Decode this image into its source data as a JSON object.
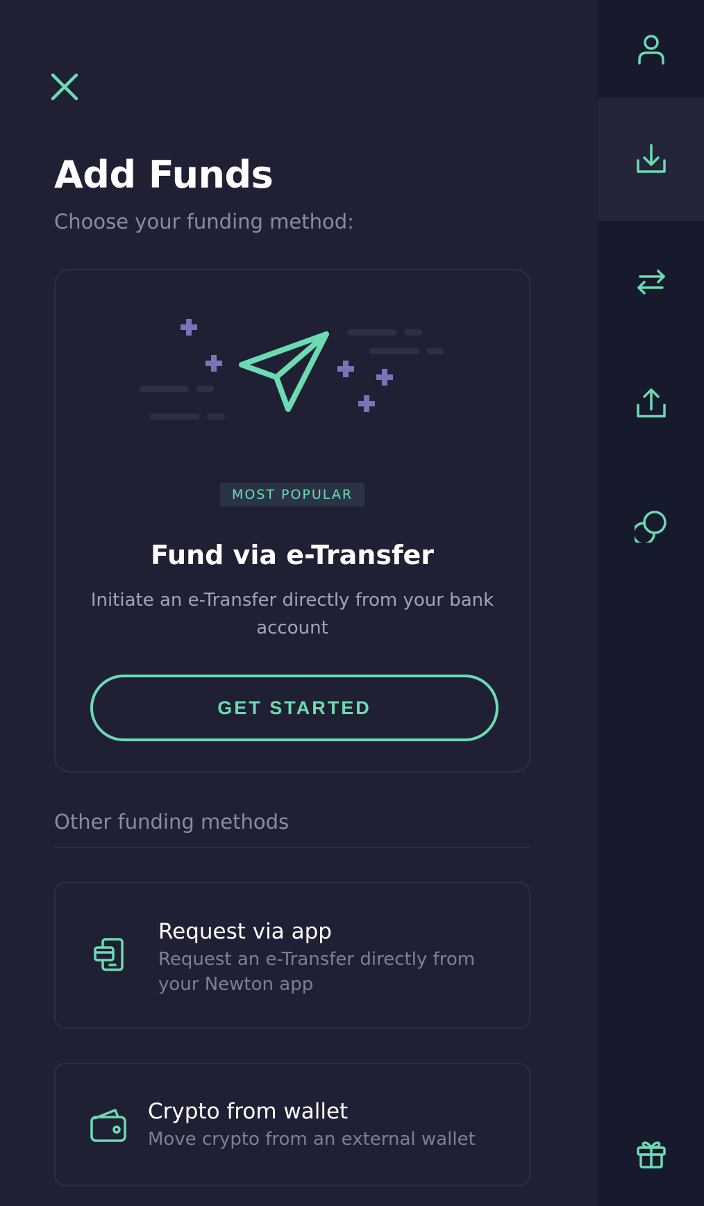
{
  "header": {
    "title": "Add Funds",
    "subtitle": "Choose your funding method:"
  },
  "featured": {
    "badge": "MOST POPULAR",
    "title": "Fund via e-Transfer",
    "description": "Initiate an e-Transfer directly from your bank account",
    "cta_label": "GET STARTED"
  },
  "other_methods": {
    "section_label": "Other funding methods",
    "items": [
      {
        "title": "Request via app",
        "description": "Request an e-Transfer directly from your Newton app",
        "icon": "phone-card-icon"
      },
      {
        "title": "Crypto from wallet",
        "description": "Move crypto from an external wallet",
        "icon": "wallet-icon"
      }
    ]
  },
  "rail": {
    "items": [
      {
        "icon": "user-icon",
        "active": false
      },
      {
        "icon": "deposit-icon",
        "active": true
      },
      {
        "icon": "swap-arrows-icon",
        "active": false
      },
      {
        "icon": "withdraw-icon",
        "active": false
      },
      {
        "icon": "coins-icon",
        "active": false
      },
      {
        "icon": "gift-icon",
        "active": false
      }
    ]
  },
  "colors": {
    "background": "#1f2034",
    "rail_background": "#171a2d",
    "accent": "#6cdbb1",
    "illustration_purple": "#7c72b8",
    "muted_text": "#8a8c9e"
  }
}
